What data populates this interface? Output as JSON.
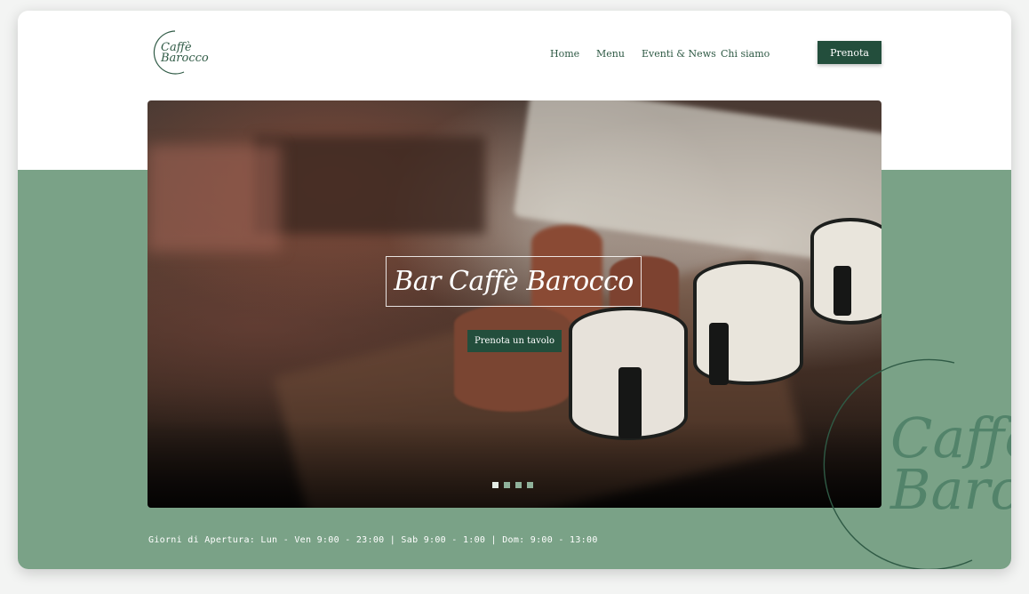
{
  "logo": {
    "line1": "Caffè",
    "line2": "Barocco"
  },
  "nav": {
    "home": "Home",
    "menu": "Menu",
    "eventi": "Eventi & News",
    "chi_siamo": "Chi siamo"
  },
  "header": {
    "prenota_label": "Prenota"
  },
  "hero": {
    "title": "Bar Caffè Barocco",
    "cta_label": "Prenota un tavolo",
    "slides": {
      "count": 4,
      "active": 1
    }
  },
  "footer": {
    "hours": "Giorni di Apertura: Lun - Ven 9:00 - 23:00  |  Sab 9:00 - 1:00  |  Dom: 9:00 - 13:00"
  },
  "decoration": {
    "line1": "Caffè",
    "line2": "Barocco"
  },
  "colors": {
    "brand_dark": "#234e3c",
    "brand_green": "#7aa287",
    "text_green": "#2f5a45",
    "deco_green": "#52836a"
  }
}
